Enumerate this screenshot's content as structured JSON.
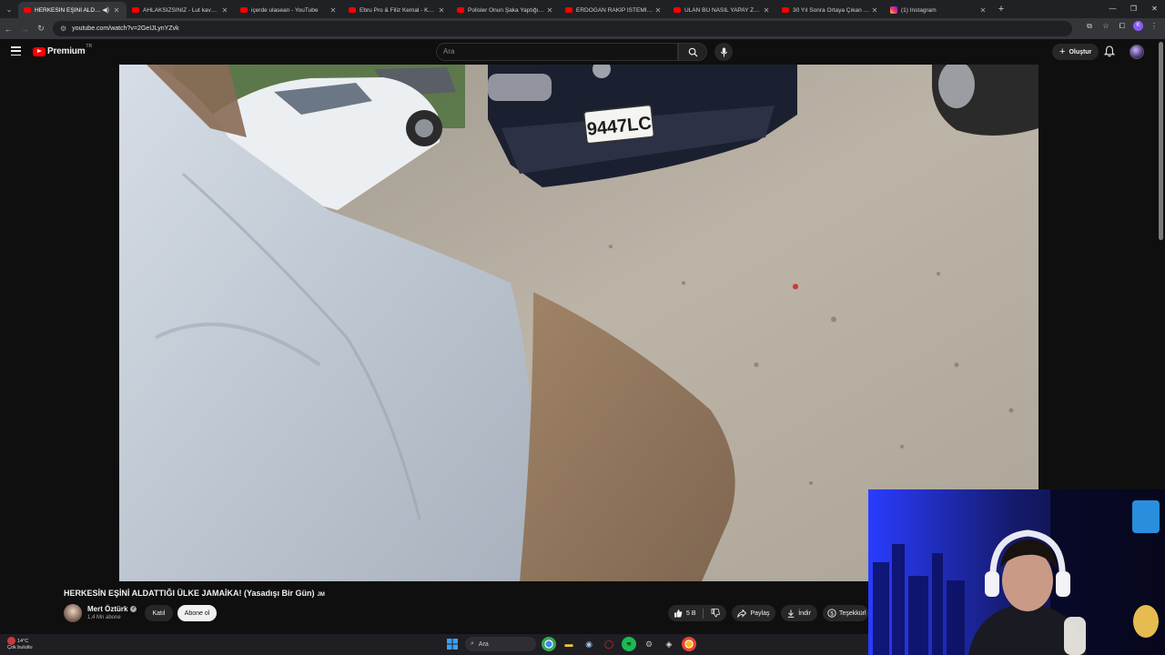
{
  "browser": {
    "tabs": [
      {
        "title": "HERKESİN EŞİNİ ALDATTIĞI",
        "active": true
      },
      {
        "title": "AHLAKSIZSINIZ - Lut kavmindir"
      },
      {
        "title": "içerde ulasean - YouTube"
      },
      {
        "title": "Ebru Pro & Filiz Kemal - Kehribar"
      },
      {
        "title": "Polisler Onun Şaka Yaptığını Sa"
      },
      {
        "title": "ERDOĞAN RAKİP İSTEMİYOR!"
      },
      {
        "title": "ULAN BU NASIL YAPAY ZEKA"
      },
      {
        "title": "30 Yıl Sonra Ortaya Çıkan Gerçek"
      },
      {
        "title": "(1) Instagram"
      }
    ],
    "url": "youtube.com/watch?v=2GeIJLynYZvk",
    "profile_initial": "K"
  },
  "header": {
    "logo_word": "Premium",
    "logo_country": "TR",
    "search_placeholder": "Ara",
    "create_label": "Oluştur"
  },
  "video": {
    "title": "HERKESİN EŞİNİ ALDATTIĞI ÜLKE JAMAİKA! (Yasadışı Bir Gün)",
    "title_tag": "JM",
    "channel": "Mert Öztürk",
    "subscribers": "1,4 Mn abone",
    "join_label": "Katıl",
    "subscribe_label": "Abone ol",
    "likes": "5 B",
    "share_label": "Paylaş",
    "download_label": "İndir",
    "thanks_label": "Teşekkürl",
    "plate_text": "9447LC"
  },
  "taskbar": {
    "temperature": "14°C",
    "condition": "Çok bulutlu",
    "search_placeholder": "Ara"
  },
  "colors": {
    "brand_red": "#ff0000",
    "background": "#0f0f0f",
    "chip": "#272727"
  }
}
